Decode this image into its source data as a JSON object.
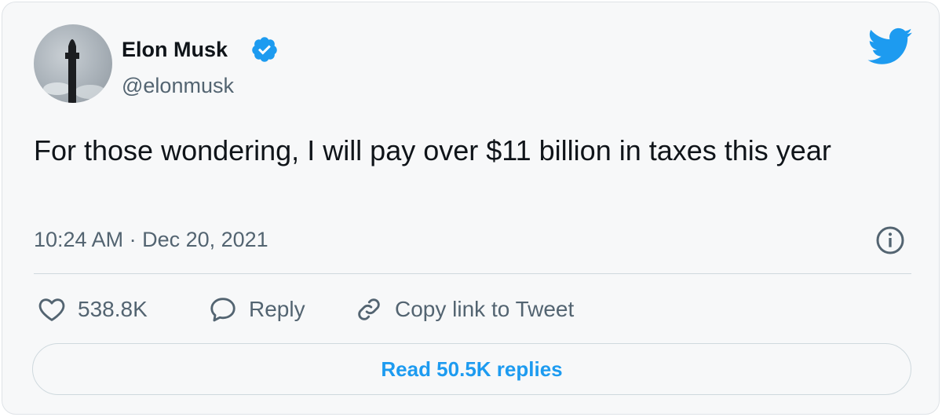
{
  "author": {
    "display_name": "Elon Musk",
    "handle": "@elonmusk",
    "verified": true
  },
  "tweet": {
    "text": "For those wondering, I will pay over $11 billion in taxes this year",
    "timestamp": "10:24 AM · Dec 20, 2021"
  },
  "actions": {
    "like_count": "538.8K",
    "reply_label": "Reply",
    "copy_link_label": "Copy link to Tweet"
  },
  "read_replies_label": "Read 50.5K replies",
  "icons": {
    "like": "heart-icon",
    "reply": "speech-bubble-icon",
    "copy_link": "link-icon",
    "info": "info-icon",
    "brand": "twitter-bird-icon",
    "verified": "verified-badge-icon"
  },
  "colors": {
    "brand_blue": "#1d9bf0",
    "text_primary": "#0f1419",
    "text_secondary": "#536471",
    "card_background": "#f7f8f9",
    "border": "#cfd9de"
  }
}
